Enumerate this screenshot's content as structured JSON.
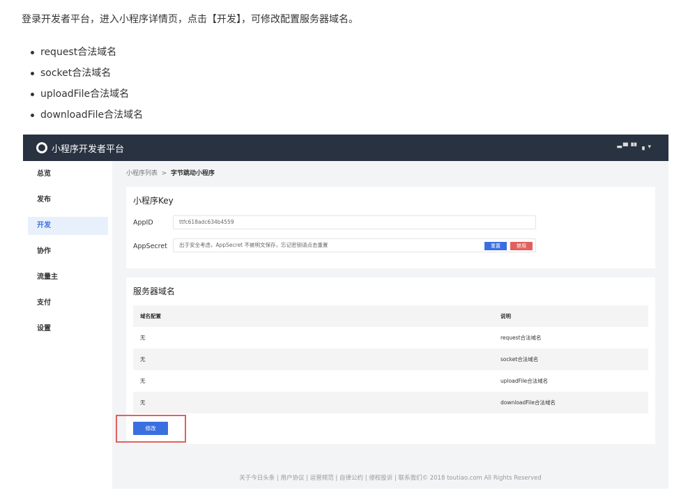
{
  "intro": "登录开发者平台，进入小程序详情页，点击【开发】，可修改配置服务器域名。",
  "bullets": [
    "request合法域名",
    "socket合法域名",
    "uploadFile合法域名",
    "downloadFile合法域名"
  ],
  "app": {
    "brand": "小程序开发者平台",
    "user": "▬▀▝▘▗ ▾",
    "sidebar": [
      {
        "label": "总览"
      },
      {
        "label": "发布"
      },
      {
        "label": "开发",
        "active": true
      },
      {
        "label": "协作"
      },
      {
        "label": "流量主"
      },
      {
        "label": "支付"
      },
      {
        "label": "设置"
      }
    ],
    "breadcrumb": {
      "parent": "小程序列表",
      "sep": ">",
      "current": "字节跳动小程序"
    },
    "key_card": {
      "title": "小程序Key",
      "appid_label": "AppID",
      "appid_value": "ttfc618adc634b4559",
      "secret_label": "AppSecret",
      "secret_hint": "出于安全考虑，AppSecret 不被明文保存，忘记密钥请点击重置",
      "reset": "重置",
      "disable": "禁用"
    },
    "domain_card": {
      "title": "服务器域名",
      "headers": [
        "域名配置",
        "说明"
      ],
      "rows": [
        [
          "无",
          "request合法域名"
        ],
        [
          "无",
          "socket合法域名"
        ],
        [
          "无",
          "uploadFile合法域名"
        ],
        [
          "无",
          "downloadFile合法域名"
        ]
      ],
      "modify": "修改"
    },
    "footer": "关于今日头条 | 用户协议 | 运营规范 | 自律公约 | 侵权投诉 | 联系我们© 2018 toutiao.com All Rights Reserved"
  },
  "colors": {
    "header": "#283240",
    "primary": "#3a6fe0",
    "danger": "#e0615c"
  }
}
